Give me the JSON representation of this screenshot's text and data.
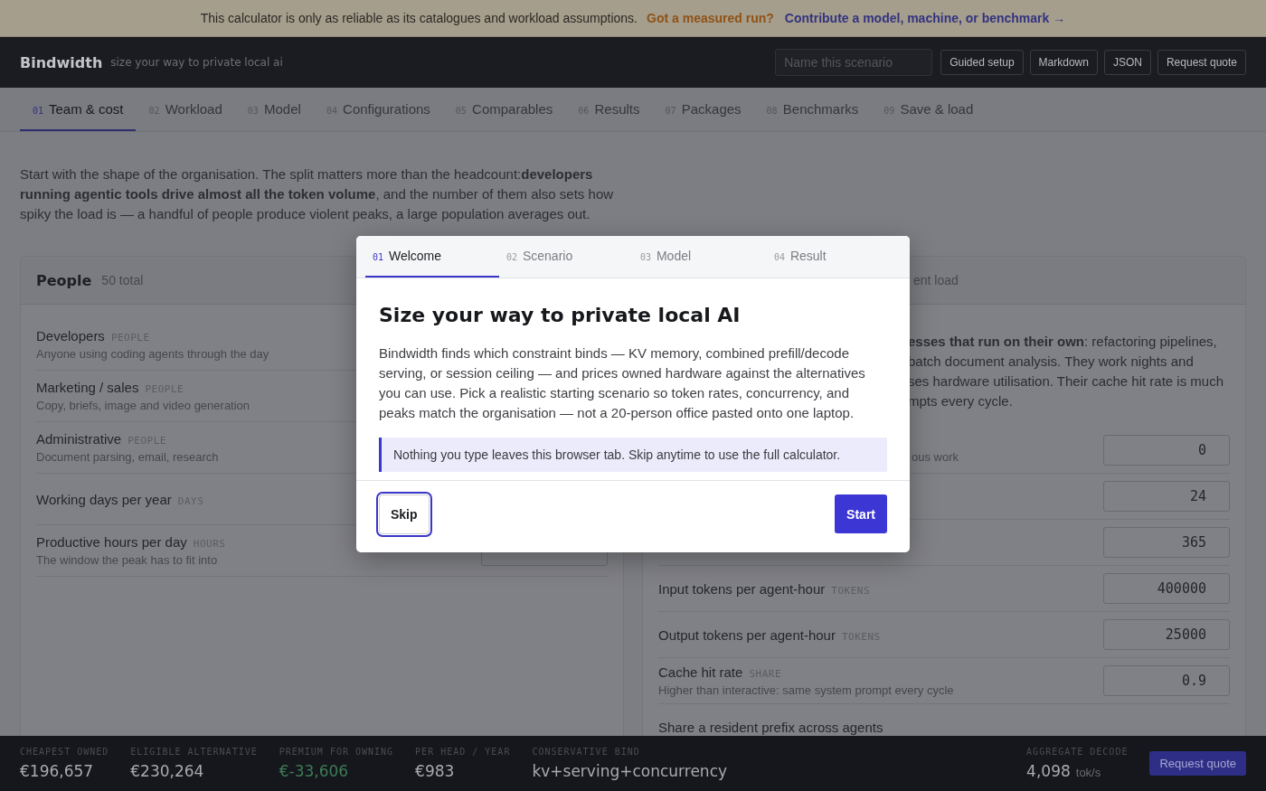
{
  "banner": {
    "text": "This calculator is only as reliable as its catalogues and workload assumptions.",
    "links": [
      {
        "text": "Got a measured run?",
        "kind": "warning"
      },
      {
        "text": "Contribute a model, machine, or benchmark →",
        "kind": "accent"
      }
    ]
  },
  "header": {
    "brand": "Bindwidth",
    "tagline": "size your way to private local ai",
    "scenario_placeholder": "Name this scenario",
    "buttons": [
      "Guided setup",
      "Markdown",
      "JSON",
      "Request quote"
    ]
  },
  "tabs": [
    {
      "number": "01",
      "label": "Team & cost",
      "selected": true
    },
    {
      "number": "02",
      "label": "Workload",
      "selected": false
    },
    {
      "number": "03",
      "label": "Model",
      "selected": false
    },
    {
      "number": "04",
      "label": "Configurations",
      "selected": false
    },
    {
      "number": "05",
      "label": "Comparables",
      "selected": false
    },
    {
      "number": "06",
      "label": "Results",
      "selected": false
    },
    {
      "number": "07",
      "label": "Packages",
      "selected": false
    },
    {
      "number": "08",
      "label": "Benchmarks",
      "selected": false
    },
    {
      "number": "09",
      "label": "Save & load",
      "selected": false
    }
  ],
  "intro": "Start with the shape of the organisation. The split matters more than the headcount:**developers running agentic tools drive almost all the token volume**, and the number of them also sets how spiky the load is — a handful of people produce violent peaks, a large population averages out.",
  "people_panel": {
    "title": "People",
    "count": "50 total",
    "rows": [
      {
        "kind": "plain",
        "label": "Developers",
        "unit": "PEOPLE",
        "hint": "Anyone using coding agents through the day"
      },
      {
        "kind": "plain",
        "label": "Marketing / sales",
        "unit": "PEOPLE",
        "hint": "Copy, briefs, image and video generation"
      },
      {
        "kind": "plain",
        "label": "Administrative",
        "unit": "PEOPLE",
        "hint": "Document parsing, email, research"
      },
      {
        "kind": "plain",
        "label": "Working days per year",
        "unit": "DAYS"
      },
      {
        "kind": "field",
        "label": "Productive hours per day",
        "unit": "HOURS",
        "hint": "The window the peak has to fit into"
      }
    ]
  },
  "agent_panel": {
    "title_fragment": "ent load",
    "intro_lines": [
      "**esses that run on their own**: refactoring pipelines,",
      "batch document analysis. They work nights and",
      "ses hardware utilisation. Their cache hit rate is much",
      "mpts every cycle."
    ],
    "rows": [
      {
        "hint": "ous work",
        "value": "0"
      },
      {
        "value": "24"
      },
      {
        "value": "365"
      },
      {
        "label": "Input tokens per agent-hour",
        "unit": "TOKENS",
        "value": "400000"
      },
      {
        "label": "Output tokens per agent-hour",
        "unit": "TOKENS",
        "value": "25000"
      },
      {
        "label": "Cache hit rate",
        "unit": "SHARE",
        "hint": "Higher than interactive: same system prompt every cycle",
        "value": "0.9"
      },
      {
        "label": "Share a resident prefix across agents"
      }
    ]
  },
  "summary_bar": {
    "stats": [
      {
        "label": "CHEAPEST OWNED",
        "value": "€196,657",
        "color": "#a9aaae"
      },
      {
        "label": "ELIGIBLE ALTERNATIVE",
        "value": "€230,264",
        "color": "#a9aaae"
      },
      {
        "label": "PREMIUM FOR OWNING",
        "value": "€-33,606",
        "color": "#3d7c57"
      },
      {
        "label": "PER HEAD / YEAR",
        "value": "€983",
        "color": "#a9aaae"
      },
      {
        "label": "CONSERVATIVE BIND",
        "value": "kv+serving+concurrency",
        "color": "#a9aaae"
      }
    ],
    "aggregate": {
      "label": "AGGREGATE DECODE",
      "value": "4,098",
      "unit": "tok/s"
    },
    "button": "Request quote"
  },
  "modal": {
    "tabs": [
      {
        "number": "01",
        "label": "Welcome",
        "selected": true
      },
      {
        "number": "02",
        "label": "Scenario",
        "selected": false
      },
      {
        "number": "03",
        "label": "Model",
        "selected": false
      },
      {
        "number": "04",
        "label": "Result",
        "selected": false
      }
    ],
    "heading": "Size your way to private local AI",
    "body": "Bindwidth finds which constraint binds — KV memory, combined prefill/decode serving, or session ceiling — and prices owned hardware against the alternatives you can use. Pick a realistic starting scenario so token rates, concurrency, and peaks match the organisation — not a 20-person office pasted onto one laptop.",
    "note": "Nothing you type leaves this browser tab. Skip anytime to use the full calculator.",
    "skip": {
      "label": "Skip",
      "focused": true
    },
    "start": "Start"
  }
}
